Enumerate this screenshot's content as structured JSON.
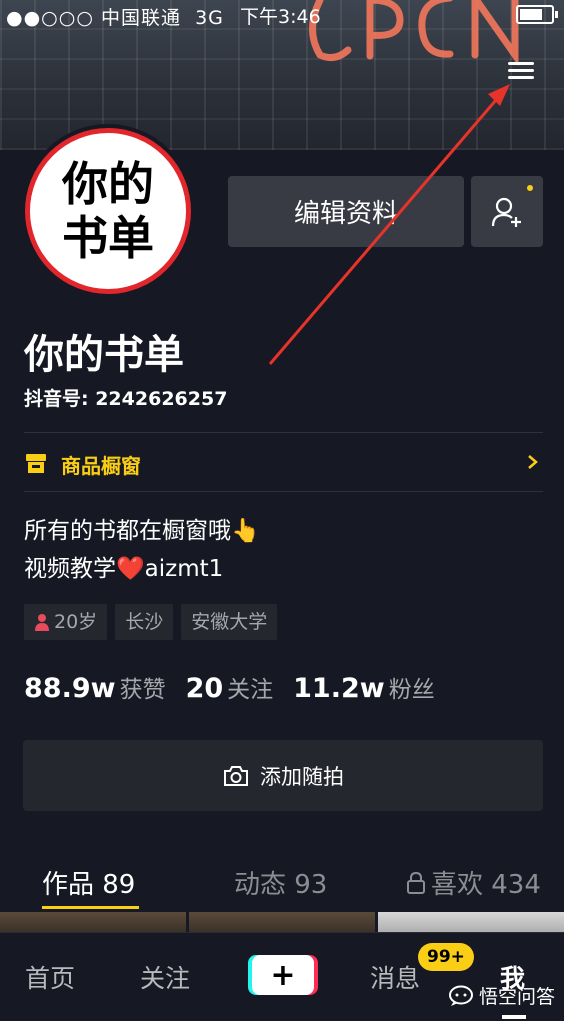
{
  "status_bar": {
    "signal": "●●○○○",
    "carrier": "中国联通",
    "network": "3G",
    "time": "下午3:46",
    "battery_level": 0.85
  },
  "profile": {
    "avatar_text": "你的书单",
    "name": "你的书单",
    "douyin_id": "抖音号: 2242626257",
    "edit_button": "编辑资料",
    "shop_window": "商品橱窗",
    "bio_line1": "所有的书都在橱窗哦👆",
    "bio_line2_a": "视频教学",
    "bio_line2_b": "❤️",
    "bio_line2_c": "aizmt1",
    "tags": {
      "age": "20岁",
      "city": "长沙",
      "school": "安徽大学"
    },
    "stats": {
      "likes_num": "88.9w",
      "likes_label": "获赞",
      "following_num": "20",
      "following_label": "关注",
      "followers_num": "11.2w",
      "followers_label": "粉丝"
    },
    "add_snap": "添加随拍"
  },
  "tabs": {
    "works": "作品 89",
    "moments": "动态 93",
    "likes": "喜欢 434"
  },
  "bottom_nav": {
    "home": "首页",
    "follow": "关注",
    "plus": "+",
    "messages": "消息",
    "messages_badge": "99+",
    "me": "我"
  },
  "watermark": "悟空问答",
  "colors": {
    "background": "#161823",
    "accent_yellow": "#face15",
    "avatar_ring": "#e1262c",
    "arrow": "#e8332a"
  }
}
